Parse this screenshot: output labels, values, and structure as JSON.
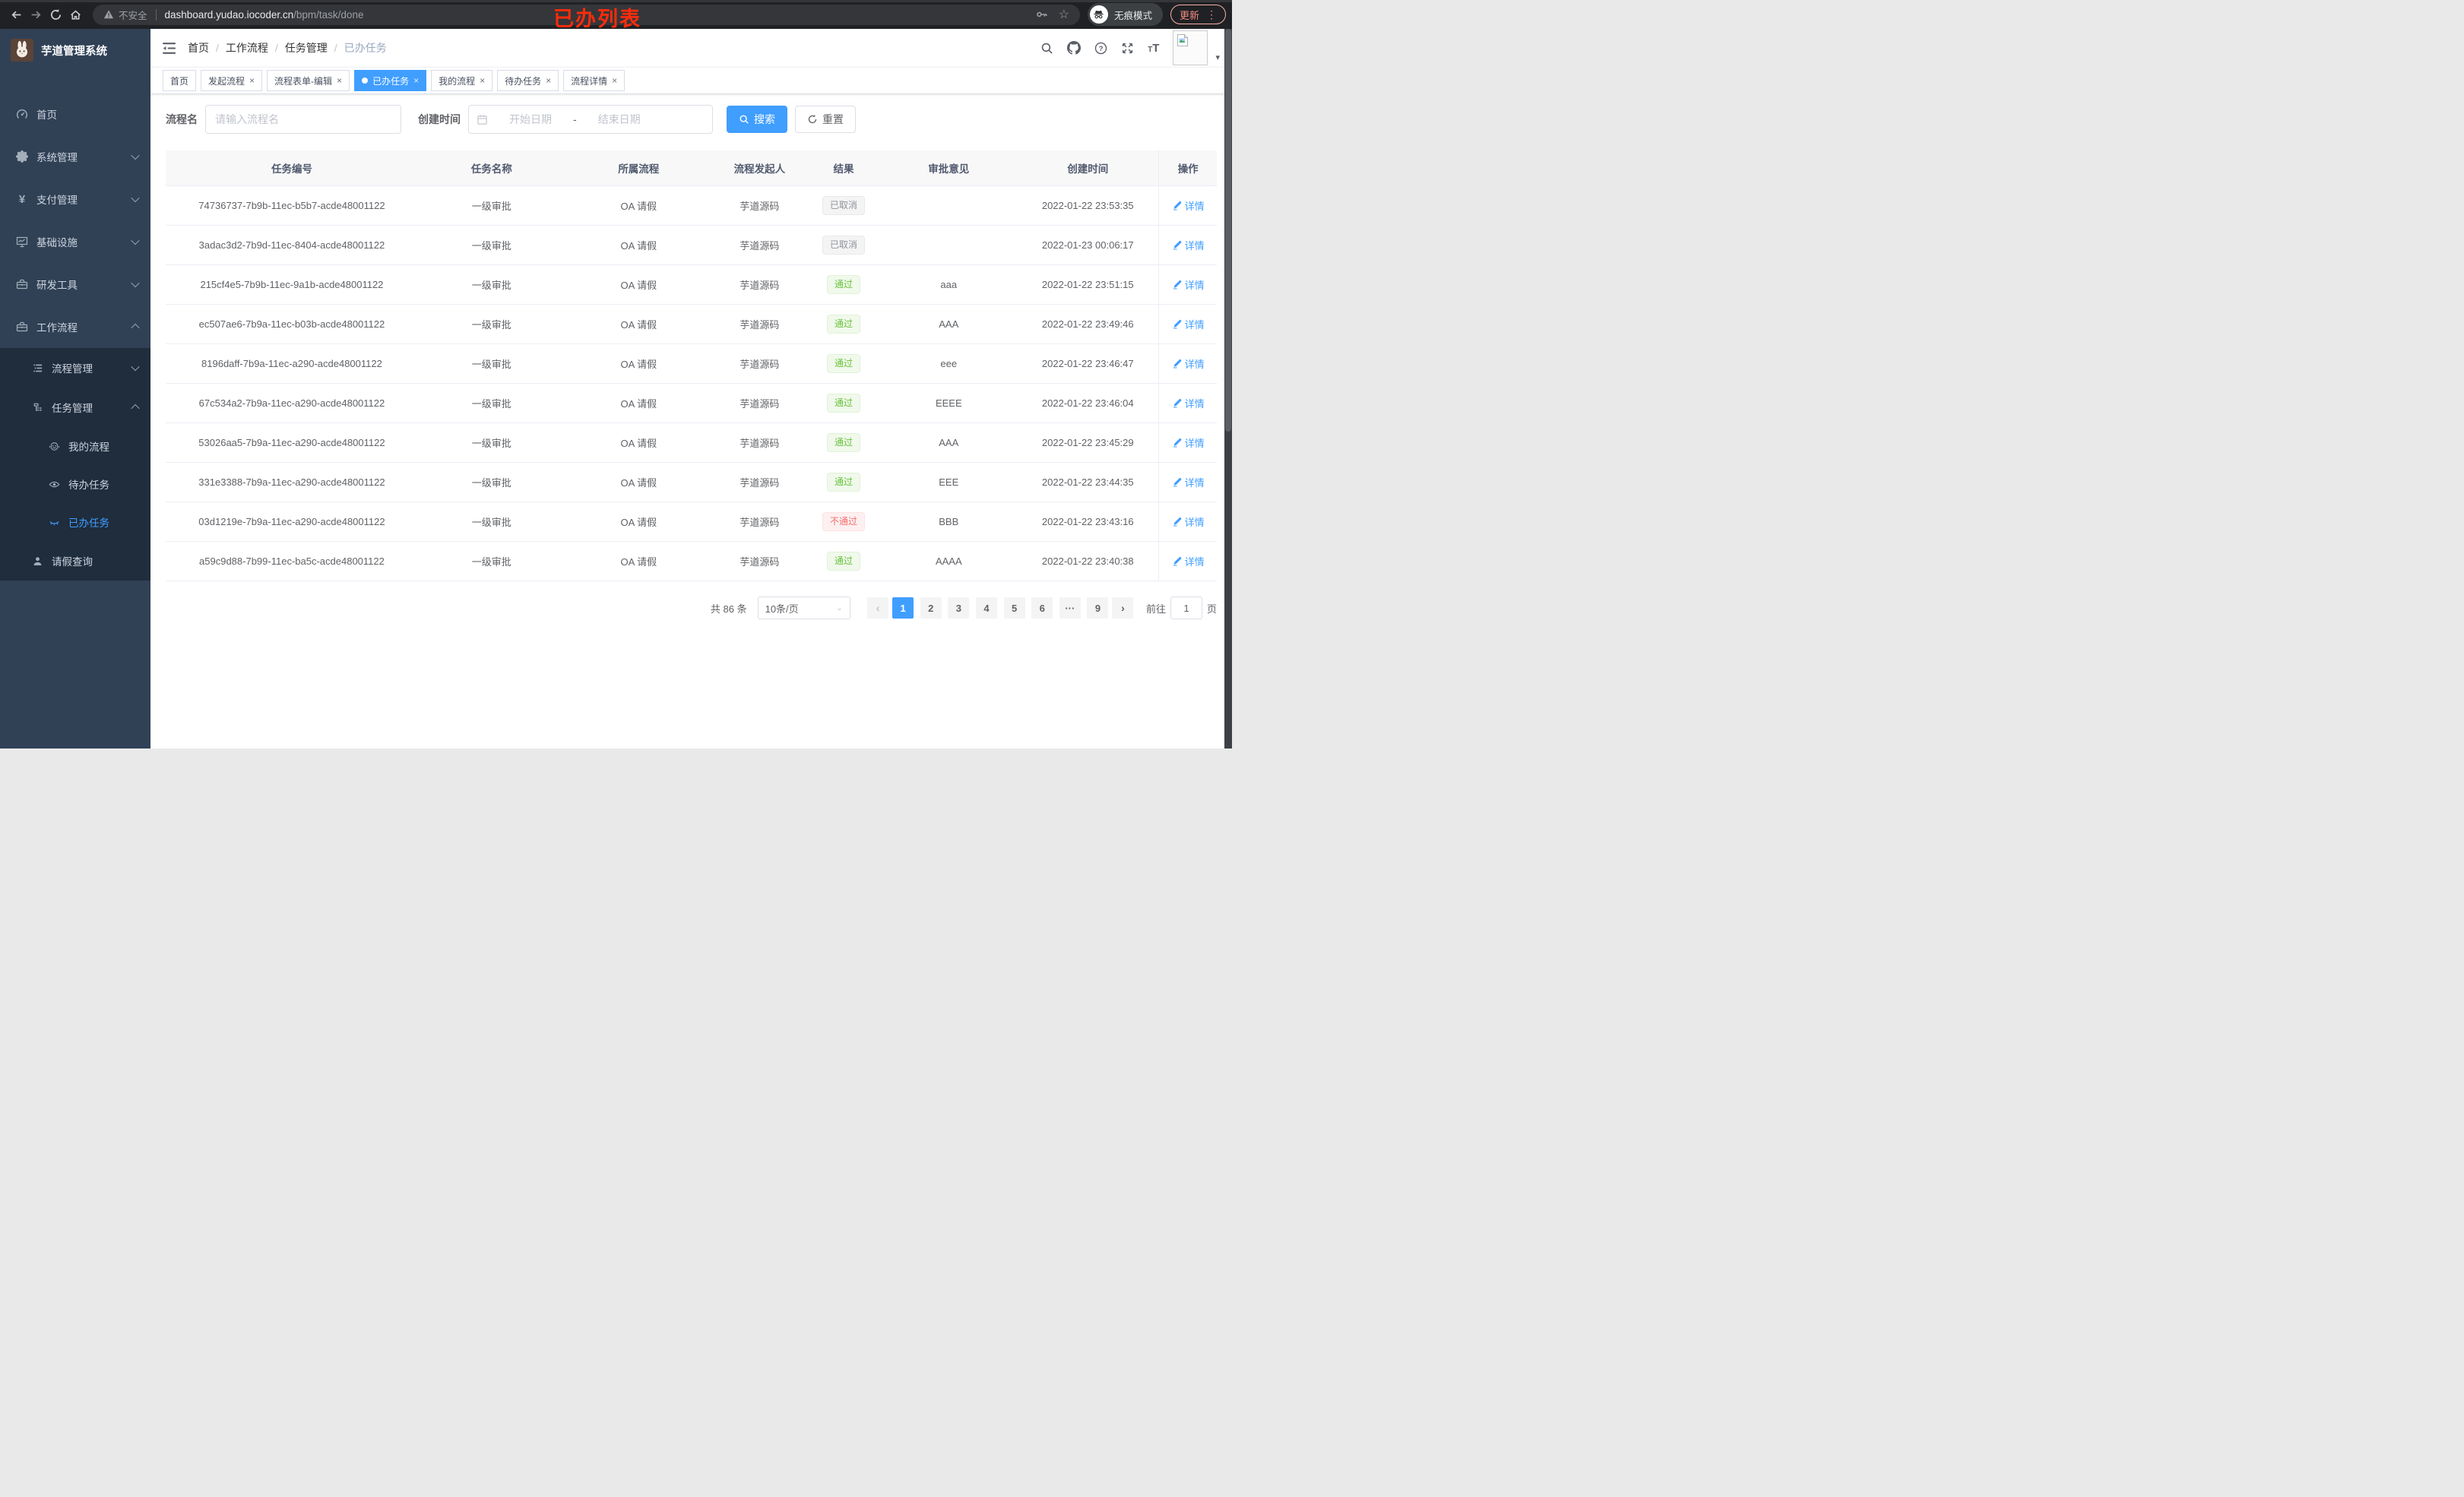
{
  "annotation": {
    "text": "已办列表"
  },
  "browser": {
    "security_label": "不安全",
    "url_host": "dashboard.yudao.iocoder.cn",
    "url_path": "/bpm/task/done",
    "incognito_label": "无痕模式",
    "update_label": "更新"
  },
  "sidebar": {
    "app_title": "芋道管理系统",
    "items": [
      {
        "label": "首页"
      },
      {
        "label": "系统管理"
      },
      {
        "label": "支付管理"
      },
      {
        "label": "基础设施"
      },
      {
        "label": "研发工具"
      },
      {
        "label": "工作流程"
      },
      {
        "label": "流程管理"
      },
      {
        "label": "任务管理"
      },
      {
        "label": "我的流程"
      },
      {
        "label": "待办任务"
      },
      {
        "label": "已办任务"
      },
      {
        "label": "请假查询"
      }
    ]
  },
  "breadcrumb": {
    "items": [
      "首页",
      "工作流程",
      "任务管理",
      "已办任务"
    ],
    "separator": "/"
  },
  "tags": [
    {
      "label": "首页",
      "closable": false
    },
    {
      "label": "发起流程",
      "closable": true
    },
    {
      "label": "流程表单-编辑",
      "closable": true
    },
    {
      "label": "已办任务",
      "closable": true,
      "state": "active"
    },
    {
      "label": "我的流程",
      "closable": true
    },
    {
      "label": "待办任务",
      "closable": true
    },
    {
      "label": "流程详情",
      "closable": true
    }
  ],
  "filters": {
    "name_label": "流程名",
    "name_placeholder": "请输入流程名",
    "time_label": "创建时间",
    "start_placeholder": "开始日期",
    "separator": "-",
    "end_placeholder": "结束日期",
    "search_label": "搜索",
    "reset_label": "重置"
  },
  "table": {
    "columns": [
      "任务编号",
      "任务名称",
      "所属流程",
      "流程发起人",
      "结果",
      "审批意见",
      "创建时间",
      "操作"
    ],
    "action_label": "详情",
    "rows": [
      {
        "id": "74736737-7b9b-11ec-b5b7-acde48001122",
        "name": "一级审批",
        "process": "OA 请假",
        "starter": "芋道源码",
        "result": "已取消",
        "result_type": "info",
        "opinion": "",
        "created": "2022-01-22 23:53:35"
      },
      {
        "id": "3adac3d2-7b9d-11ec-8404-acde48001122",
        "name": "一级审批",
        "process": "OA 请假",
        "starter": "芋道源码",
        "result": "已取消",
        "result_type": "info",
        "opinion": "",
        "created": "2022-01-23 00:06:17"
      },
      {
        "id": "215cf4e5-7b9b-11ec-9a1b-acde48001122",
        "name": "一级审批",
        "process": "OA 请假",
        "starter": "芋道源码",
        "result": "通过",
        "result_type": "success",
        "opinion": "aaa",
        "created": "2022-01-22 23:51:15"
      },
      {
        "id": "ec507ae6-7b9a-11ec-b03b-acde48001122",
        "name": "一级审批",
        "process": "OA 请假",
        "starter": "芋道源码",
        "result": "通过",
        "result_type": "success",
        "opinion": "AAA",
        "created": "2022-01-22 23:49:46"
      },
      {
        "id": "8196daff-7b9a-11ec-a290-acde48001122",
        "name": "一级审批",
        "process": "OA 请假",
        "starter": "芋道源码",
        "result": "通过",
        "result_type": "success",
        "opinion": "eee",
        "created": "2022-01-22 23:46:47"
      },
      {
        "id": "67c534a2-7b9a-11ec-a290-acde48001122",
        "name": "一级审批",
        "process": "OA 请假",
        "starter": "芋道源码",
        "result": "通过",
        "result_type": "success",
        "opinion": "EEEE",
        "created": "2022-01-22 23:46:04"
      },
      {
        "id": "53026aa5-7b9a-11ec-a290-acde48001122",
        "name": "一级审批",
        "process": "OA 请假",
        "starter": "芋道源码",
        "result": "通过",
        "result_type": "success",
        "opinion": "AAA",
        "created": "2022-01-22 23:45:29"
      },
      {
        "id": "331e3388-7b9a-11ec-a290-acde48001122",
        "name": "一级审批",
        "process": "OA 请假",
        "starter": "芋道源码",
        "result": "通过",
        "result_type": "success",
        "opinion": "EEE",
        "created": "2022-01-22 23:44:35"
      },
      {
        "id": "03d1219e-7b9a-11ec-a290-acde48001122",
        "name": "一级审批",
        "process": "OA 请假",
        "starter": "芋道源码",
        "result": "不通过",
        "result_type": "danger",
        "opinion": "BBB",
        "created": "2022-01-22 23:43:16"
      },
      {
        "id": "a59c9d88-7b99-11ec-ba5c-acde48001122",
        "name": "一级审批",
        "process": "OA 请假",
        "starter": "芋道源码",
        "result": "通过",
        "result_type": "success",
        "opinion": "AAAA",
        "created": "2022-01-22 23:40:38"
      }
    ]
  },
  "pagination": {
    "total": "共 86 条",
    "page_size": "10条/页",
    "prev": "‹",
    "next": "›",
    "pages": [
      {
        "label": "1",
        "type": "active"
      },
      {
        "label": "2"
      },
      {
        "label": "3"
      },
      {
        "label": "4"
      },
      {
        "label": "5"
      },
      {
        "label": "6"
      },
      {
        "label": "···",
        "type": "more"
      },
      {
        "label": "9"
      }
    ],
    "goto_label": "前往",
    "goto_value": "1",
    "page_unit": "页"
  },
  "icons": {
    "close": "×",
    "caret": "▾",
    "dots": "⋮",
    "star": "☆"
  },
  "colors": {
    "accent": "#409eff",
    "success": "#67c23a",
    "danger": "#f56c6c",
    "info": "#909399",
    "sidebar_bg": "#304156",
    "submenu_bg": "#1f2d3d",
    "annotation": "#fb2c0b"
  }
}
